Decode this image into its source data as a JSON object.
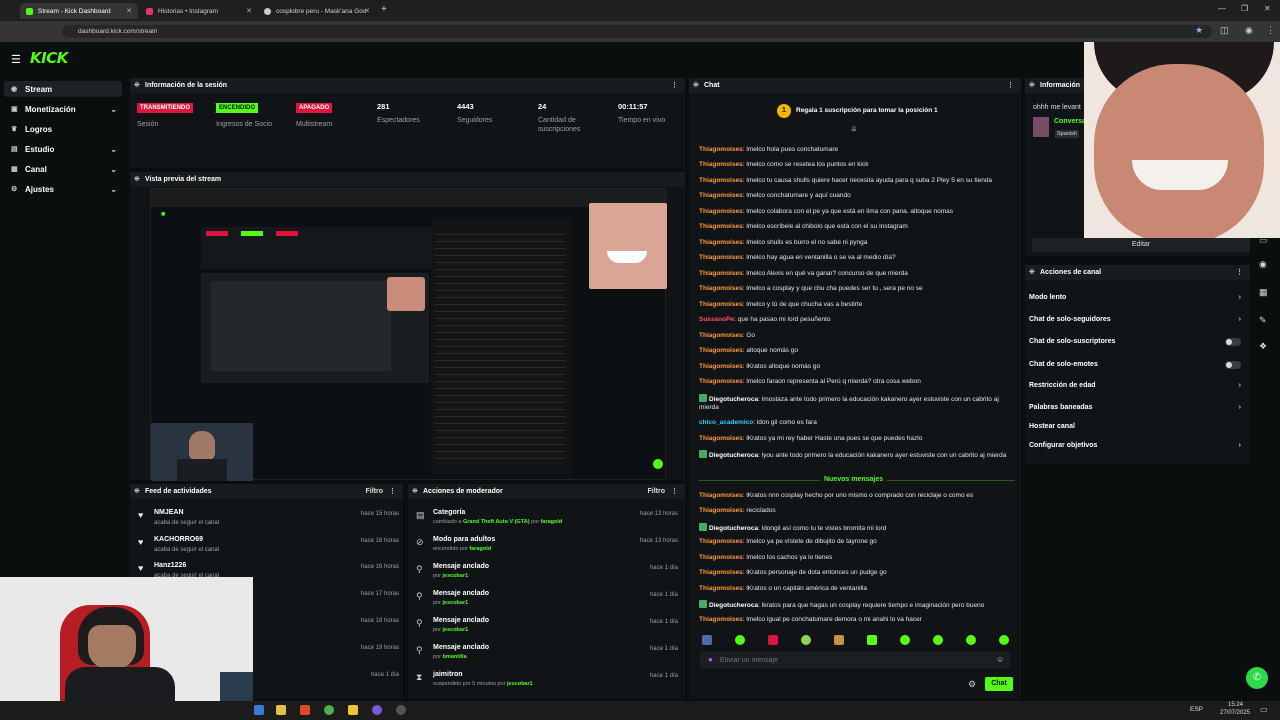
{
  "browser": {
    "tabs": [
      {
        "title": "Stream - Kick Dashboard",
        "color": "#53fc18"
      },
      {
        "title": "Historias • Instagram",
        "color": "#e1306c"
      },
      {
        "title": "cosplobre peru - Mask'ana Goo",
        "color": "#cccccc"
      }
    ],
    "url": "dashboard.kick.com/stream"
  },
  "app": {
    "logo": "KICK"
  },
  "sidebar": {
    "items": [
      {
        "label": "Stream",
        "icon": "stream-icon",
        "active": true
      },
      {
        "label": "Monetización",
        "icon": "money-icon",
        "chevron": true
      },
      {
        "label": "Logros",
        "icon": "trophy-icon"
      },
      {
        "label": "Estudio",
        "icon": "studio-icon",
        "chevron": true
      },
      {
        "label": "Canal",
        "icon": "channel-icon",
        "chevron": true
      },
      {
        "label": "Ajustes",
        "icon": "gear-icon",
        "chevron": true
      }
    ]
  },
  "session": {
    "title": "Información de la sesión",
    "stats": [
      {
        "badge": "TRANSMITIENDO",
        "badge_color": "#e0143c",
        "label": "Sesión"
      },
      {
        "badge": "ENCENDIDO",
        "badge_color": "#53fc18",
        "label": "Ingresos de Socio"
      },
      {
        "badge": "APAGADO",
        "badge_color": "#e0143c",
        "label": "Multistream"
      },
      {
        "num": "281",
        "label": "Espectadores"
      },
      {
        "num": "4443",
        "label": "Seguidores"
      },
      {
        "num": "24",
        "label": "Cantidad de suscripciones"
      },
      {
        "num": "00:11:57",
        "label": "Tiempo en vivo"
      }
    ]
  },
  "preview": {
    "title": "Vista previa del stream"
  },
  "feed": {
    "title": "Feed de actividades",
    "filter": "Filtro",
    "rows": [
      {
        "name": "NMJEAN",
        "sub": "acaba de seguir el canal",
        "time": "hace 15 horas"
      },
      {
        "name": "KACHORRO69",
        "sub": "acaba de seguir el canal",
        "time": "hace 16 horas"
      },
      {
        "name": "Hanz1226",
        "sub": "acaba de seguir el canal",
        "time": "hace 16 horas"
      },
      {
        "time": "hace 17 horas"
      },
      {
        "time": "hace 18 horas"
      },
      {
        "time": "hace 19 horas"
      },
      {
        "time": "hace 1 día"
      }
    ]
  },
  "mod": {
    "title": "Acciones de moderador",
    "filter": "Filtro",
    "rows": [
      {
        "title": "Categoría",
        "pre": "cambiado a",
        "hl": "Grand Theft Auto V (GTA)",
        "mid": "por",
        "by": "faragold",
        "time": "hace 13 horas",
        "icon": "category-icon"
      },
      {
        "title": "Modo para adultos",
        "pre": "encendido por",
        "hl": "",
        "mid": "",
        "by": "faragold",
        "time": "hace 13 horas",
        "icon": "adult-mode-icon"
      },
      {
        "title": "Mensaje anclado",
        "pre": "por",
        "hl": "",
        "mid": "",
        "by": "jescobar1",
        "time": "hace 1 día",
        "icon": "pin-icon"
      },
      {
        "title": "Mensaje anclado",
        "pre": "por",
        "hl": "",
        "mid": "",
        "by": "jescobar1",
        "time": "hace 1 día",
        "icon": "pin-icon"
      },
      {
        "title": "Mensaje anclado",
        "pre": "por",
        "hl": "",
        "mid": "",
        "by": "jescobar1",
        "time": "hace 1 día",
        "icon": "pin-icon"
      },
      {
        "title": "Mensaje anclado",
        "pre": "por",
        "hl": "",
        "mid": "",
        "by": "bmantilla",
        "time": "hace 1 día",
        "icon": "pin-icon"
      },
      {
        "title": "jaimitron",
        "pre": "suspendido por 5 minutos por",
        "hl": "",
        "mid": "",
        "by": "jescobar1",
        "time": "hace 1 día",
        "icon": "timer-icon"
      }
    ]
  },
  "chat": {
    "title": "Chat",
    "promo": "Regala 1 suscripción para tomar la posición 1",
    "new_messages": "Nuevos mensajes",
    "input_placeholder": "Enviar un mensaje",
    "send_label": "Chat",
    "messages": [
      {
        "user": "Thiagomoises",
        "text": "lmelco hola pues conchatumare",
        "cls": ""
      },
      {
        "user": "Thiagomoises",
        "text": "lmelco como se resetea los puntos en kick",
        "cls": ""
      },
      {
        "user": "Thiagomoises",
        "text": "lmelco tu causa shulls quiere hacer necesita ayuda para q suba 2 Pley 5 en su tienda",
        "cls": ""
      },
      {
        "user": "Thiagomoises",
        "text": "lmelco conchatumare y aquí cuando",
        "cls": ""
      },
      {
        "user": "Thiagomoises",
        "text": "lmelco colabora con el pe ya que está en lima con pana. altoque nomas",
        "cls": ""
      },
      {
        "user": "Thiagomoises",
        "text": "lmelco escríbele al chibolo que está con el su Instagram",
        "cls": ""
      },
      {
        "user": "Thiagomoises",
        "text": "lmelco shulls es burro el no sabe ni pynga",
        "cls": ""
      },
      {
        "user": "Thiagomoises",
        "text": "lmelco hay agua en ventanilla o se va al medio día?",
        "cls": ""
      },
      {
        "user": "Thiagomoises",
        "text": "lmelco Alexis en qué va ganar? concurso de que mierda",
        "cls": ""
      },
      {
        "user": "Thiagomoises",
        "text": "lmelco a cosplay y que chu cha puedes ser tu , sera pe no se",
        "cls": ""
      },
      {
        "user": "Thiagomoises",
        "text": "lmelco y tú de que chucha vas a bestirte",
        "cls": ""
      },
      {
        "user": "SussanoPe",
        "text": "que ha pasao mi lord pesuñento",
        "cls": "red"
      },
      {
        "user": "Thiagomoises",
        "text": "Go",
        "cls": ""
      },
      {
        "user": "Thiagomoises",
        "text": "altoque nomás go",
        "cls": ""
      },
      {
        "user": "Thiagomoises",
        "text": "lKratos altoque nomás go",
        "cls": ""
      },
      {
        "user": "Thiagomoises",
        "text": "lmelco faraon representa al Perú q mierda? otra cosa webon",
        "cls": ""
      },
      {
        "user": "Diegotucheroca",
        "text": "lmostaza ante todo primero la educación kakanero ayer estuviste con un cabrito aj mierda",
        "cls": "white",
        "badge": true
      },
      {
        "user": "chico_academico",
        "text": "ldon gil como es fara",
        "cls": "cyan"
      },
      {
        "user": "Thiagomoises",
        "text": "lKratos ya mi rey haber Haste una pues se que puedes hazlo",
        "cls": ""
      },
      {
        "user": "Diegotucheroca",
        "text": "lyou ante todo primero la educación kakanero ayer estuviste con un cabrito aj mierda",
        "cls": "white",
        "badge": true
      },
      {
        "user": "Thiagomoises",
        "text": "lKratos nnn cosplay hecho por uno mismo o comprado con reciclaje o como es",
        "cls": ""
      },
      {
        "user": "Thiagomoises",
        "text": "reciclados",
        "cls": ""
      },
      {
        "user": "Diegotucheroca",
        "text": "ldongil así como tu te vistes bromita mi lord",
        "cls": "white",
        "badge": true
      },
      {
        "user": "Thiagomoises",
        "text": "lmelco ya pe vístete de dibujito de tayrone go",
        "cls": ""
      },
      {
        "user": "Thiagomoises",
        "text": "lmelco los cachos ya lo tienes",
        "cls": ""
      },
      {
        "user": "Thiagomoises",
        "text": "lKratos personaje de dota entonces un pudge go",
        "cls": ""
      },
      {
        "user": "Thiagomoises",
        "text": "lKratos o un capitán américa de ventanilla",
        "cls": ""
      },
      {
        "user": "Diegotucheroca",
        "text": "lkratos para que hagas un cosplay requiere tiempo e imaginación pero bueno",
        "cls": "white",
        "badge": true
      },
      {
        "user": "Thiagomoises",
        "text": "lmelco igual pe conchatumare demora o mi anahi lo va hacer",
        "cls": ""
      }
    ]
  },
  "info": {
    "title": "Información",
    "preview_text": "ohhh me levant",
    "tag1": "Conversa",
    "tag2": "Spanish",
    "edit_label": "Editar"
  },
  "channel_actions": {
    "title": "Acciones de canal",
    "rows": [
      {
        "label": "Modo lento",
        "type": "chevron"
      },
      {
        "label": "Chat de solo-seguidores",
        "type": "chevron"
      },
      {
        "label": "Chat de solo-suscriptores",
        "type": "toggle"
      },
      {
        "label": "Chat de solo-emotes",
        "type": "toggle"
      },
      {
        "label": "Restricción de edad",
        "type": "chevron"
      },
      {
        "label": "Palabras baneadas",
        "type": "chevron"
      },
      {
        "label": "Hostear canal",
        "type": "none"
      },
      {
        "label": "Configurar objetivos",
        "type": "chevron"
      }
    ]
  },
  "taskbar": {
    "lang": "ESP",
    "time": "15:24",
    "date": "27/07/2025"
  },
  "colors": {
    "accent": "#53fc18",
    "live_red": "#e0143c",
    "panel": "#111416",
    "bg": "#0b0e0f"
  }
}
